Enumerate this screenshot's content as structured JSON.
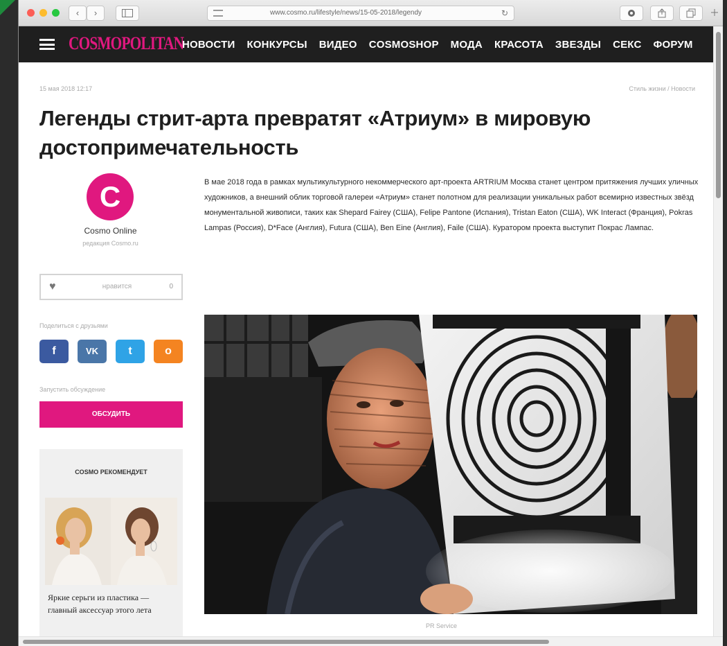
{
  "browser": {
    "url": "www.cosmo.ru/lifestyle/news/15-05-2018/legendy",
    "back": "‹",
    "forward": "›",
    "reload": "↻"
  },
  "site": {
    "logo": "COSMOPOLITAN",
    "nav": [
      "НОВОСТИ",
      "КОНКУРСЫ",
      "ВИДЕО",
      "COSMOSHOP",
      "МОДА",
      "КРАСОТА",
      "ЗВЕЗДЫ",
      "СЕКС",
      "ФОРУМ"
    ]
  },
  "article": {
    "date": "15 мая 2018 12:17",
    "breadcrumbs": "Стиль жизни / Новости",
    "title": "Легенды стрит-арта превратят «Атриум» в мировую достопримечательность",
    "body": "В мае 2018 года в рамках мультикультурного некоммерческого арт-проекта ARTRIUM Москва станет центром притяжения лучших уличных художников, а внешний облик торговой галереи «Атриум» станет полотном для реализации уникальных работ всемирно известных звёзд монументальной живописи, таких как Shepard Fairey (США), Felipe Pantone (Испания), Tristan Eaton (США), WK Interact (Франция), Pokras Lampas (Россия), D*Face (Англия), Futura (США), Ben Eine (Англия), Faile (США). Куратором проекта выступит Покрас Лампас.",
    "photo_credit": "PR Service"
  },
  "author": {
    "initial": "C",
    "name": "Cosmo Online",
    "role": "редакция Cosmo.ru"
  },
  "sidebar": {
    "like_label": "нравится",
    "like_count": "0",
    "share_label": "Поделиться с друзьями",
    "social": {
      "fb": "f",
      "vk": "VK",
      "tw": "t",
      "ok": "o"
    },
    "discuss_label": "Запустить обсуждение",
    "discuss_button": "ОБСУДИТЬ",
    "reco_title": "COSMO РЕКОМЕНДУЕТ",
    "reco_caption": "Яркие серьги из пластика — главный аксессуар этого лета"
  },
  "colors": {
    "brand_pink": "#e0187f",
    "nav_bg": "#1f1f1f",
    "facebook": "#3b5aa0",
    "vk": "#4a76a8",
    "twitter": "#2fa3e6",
    "odnoklassniki": "#f48421"
  }
}
